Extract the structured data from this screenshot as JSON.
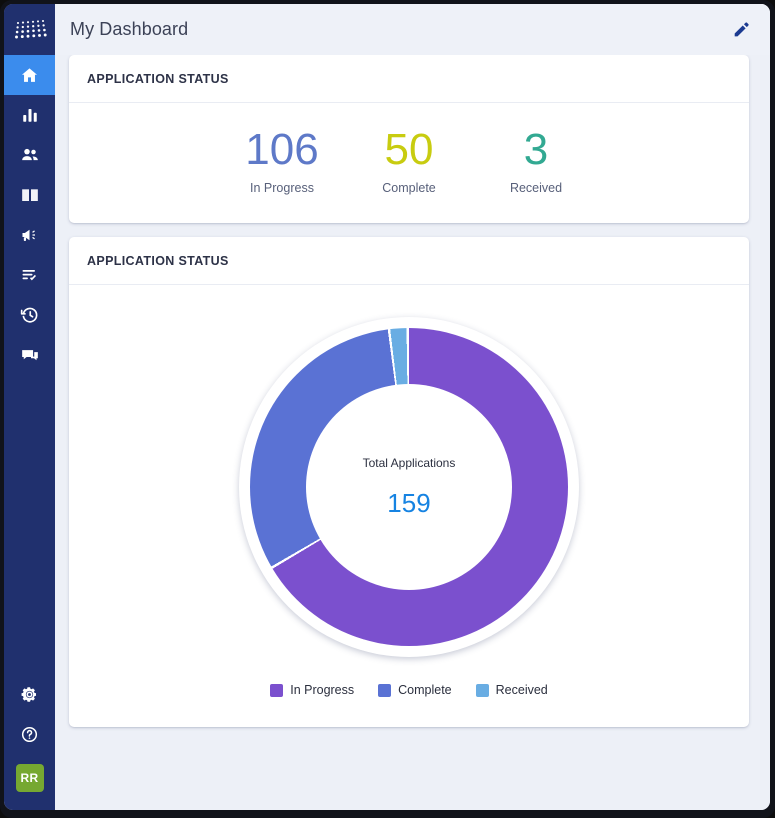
{
  "header": {
    "title": "My Dashboard",
    "edit_icon": "pencil-icon"
  },
  "sidebar": {
    "logo": "dot-grid-logo",
    "items": [
      {
        "name": "home",
        "icon": "home-icon",
        "active": true
      },
      {
        "name": "reports",
        "icon": "bar-chart-icon",
        "active": false
      },
      {
        "name": "people",
        "icon": "users-icon",
        "active": false
      },
      {
        "name": "library",
        "icon": "book-icon",
        "active": false
      },
      {
        "name": "announcements",
        "icon": "megaphone-icon",
        "active": false
      },
      {
        "name": "tasks",
        "icon": "checklist-icon",
        "active": false
      },
      {
        "name": "history",
        "icon": "history-clock-icon",
        "active": false
      },
      {
        "name": "messages",
        "icon": "chat-icon",
        "active": false
      }
    ],
    "bottom": [
      {
        "name": "settings",
        "icon": "gear-icon"
      },
      {
        "name": "help",
        "icon": "question-circle-icon"
      }
    ],
    "avatar": {
      "initials": "RR",
      "color": "#76a831"
    }
  },
  "cards": [
    {
      "title": "APPLICATION STATUS"
    },
    {
      "title": "APPLICATION STATUS"
    }
  ],
  "stats": [
    {
      "value": "106",
      "label": "In Progress",
      "color": "#5e79c8"
    },
    {
      "value": "50",
      "label": "Complete",
      "color": "#c8cc10"
    },
    {
      "value": "3",
      "label": "Received",
      "color": "#32a992"
    }
  ],
  "donut": {
    "caption": "Total Applications",
    "total": "159",
    "total_color": "#1683e2"
  },
  "chart_data": {
    "type": "pie",
    "title": "APPLICATION STATUS",
    "center_label": "Total Applications",
    "center_value": 159,
    "categories": [
      "In Progress",
      "Complete",
      "Received"
    ],
    "values": [
      106,
      50,
      3
    ],
    "colors": [
      "#7b50ce",
      "#5a72d4",
      "#69ade3"
    ],
    "percentages": [
      66.7,
      31.4,
      1.9
    ],
    "legend_position": "bottom",
    "grid": false,
    "donut": true,
    "hole_ratio": 0.65,
    "start_angle_deg": 0,
    "direction": "clockwise"
  },
  "legend": [
    {
      "label": "In Progress",
      "color": "#7b50ce"
    },
    {
      "label": "Complete",
      "color": "#5a72d4"
    },
    {
      "label": "Received",
      "color": "#69ade3"
    }
  ]
}
